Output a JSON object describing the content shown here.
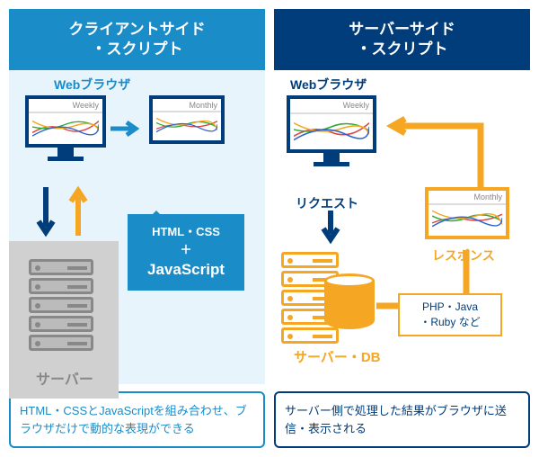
{
  "left": {
    "title": "クライアントサイド\n・スクリプト",
    "browser_label": "Webブラウザ",
    "monitor1_chart": "Weekly",
    "monitor2_chart": "Monthly",
    "server_label": "サーバー",
    "bubble_line1": "HTML・CSS",
    "bubble_plus": "＋",
    "bubble_js": "JavaScript",
    "footer": "HTML・CSSとJavaScriptを組み合わせ、ブラウザだけで動的な表現ができる"
  },
  "right": {
    "title": "サーバーサイド\n・スクリプト",
    "browser_label": "Webブラウザ",
    "monitor1_chart": "Weekly",
    "monitor2_chart": "Monthly",
    "request_label": "リクエスト",
    "response_label": "レスポンス",
    "server_label": "サーバー・DB",
    "tech_box": "PHP・Java\n・Ruby など",
    "footer": "サーバー側で処理した結果がブラウザに送信・表示される"
  }
}
